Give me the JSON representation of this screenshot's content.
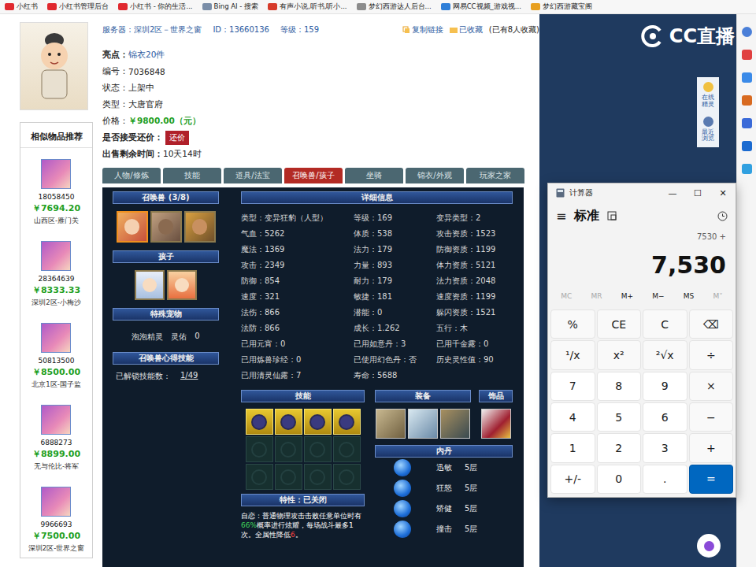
{
  "bookmarks": [
    {
      "label": "小红书",
      "color": "#e0282e"
    },
    {
      "label": "小红书管理后台",
      "color": "#e0282e"
    },
    {
      "label": "小红书 - 你的生活...",
      "color": "#e0282e"
    },
    {
      "label": "Bing AI - 搜索",
      "color": "#7a8ea8"
    },
    {
      "label": "有声小说,听书,听小...",
      "color": "#d63a2a"
    },
    {
      "label": "梦幻西游达人后台...",
      "color": "#8c8c8c"
    },
    {
      "label": "网易CC视频_游戏视...",
      "color": "#2f7fd8"
    },
    {
      "label": "梦幻西游藏宝阁",
      "color": "#e8a020"
    }
  ],
  "header": {
    "server_label": "服务器：",
    "server": "深圳2区－世界之窗",
    "id_label": "ID：",
    "id": "13660136",
    "level_label": "等级：",
    "level": "159",
    "copy": "复制链接",
    "favorite": "已收藏",
    "favorite_count": "(已有8人收藏)"
  },
  "info": [
    {
      "label": "亮点：",
      "value": "锦衣20件",
      "kind": "link"
    },
    {
      "label": "编号：",
      "value": "7036848",
      "kind": "plain"
    },
    {
      "label": "状态：",
      "value": "上架中",
      "kind": "plain"
    },
    {
      "label": "类型：",
      "value": "大唐官府",
      "kind": "plain"
    },
    {
      "label": "价格：",
      "value": "￥9800.00（元）",
      "kind": "price"
    },
    {
      "label": "是否接受还价：",
      "value": "还价",
      "kind": "button"
    },
    {
      "label": "出售剩余时间：",
      "value": "10天14时",
      "kind": "plain"
    }
  ],
  "similar": {
    "title": "相似物品推荐",
    "items": [
      {
        "id": "18058450",
        "price": "￥7694.20",
        "server": "山西区-雁门关"
      },
      {
        "id": "28364639",
        "price": "￥8333.33",
        "server": "深圳2区-小梅沙"
      },
      {
        "id": "50813500",
        "price": "￥8500.00",
        "server": "北京1区-国子监"
      },
      {
        "id": "6888273",
        "price": "￥8899.00",
        "server": "无与伦比-将军"
      },
      {
        "id": "9966693",
        "price": "￥7500.00",
        "server": "深圳2区-世界之窗"
      }
    ]
  },
  "tabs": [
    {
      "label": "人物/修炼",
      "selected": false
    },
    {
      "label": "技能",
      "selected": false
    },
    {
      "label": "道具/法宝",
      "selected": false
    },
    {
      "label": "召唤兽/孩子",
      "selected": true
    },
    {
      "label": "坐骑",
      "selected": false
    },
    {
      "label": "锦衣/外观",
      "selected": false
    },
    {
      "label": "玩家之家",
      "selected": false
    }
  ],
  "panel": {
    "pets": {
      "title": "召唤兽 (3/8)",
      "items": [
        {
          "selected": true
        },
        {
          "selected": false
        },
        {
          "selected": false
        }
      ]
    },
    "children": {
      "title": "孩子",
      "items": [
        {
          "selected": false
        },
        {
          "selected": false
        }
      ]
    },
    "special": {
      "title": "特殊宠物",
      "name": "泡泡精灵",
      "label": "灵佑",
      "value": "0"
    },
    "insight": {
      "title": "召唤兽心得技能",
      "label": "已解锁技能数：",
      "value": "1/49"
    },
    "detail": {
      "title": "详细信息",
      "cells": [
        "类型：变异狂豹（人型）",
        "等级：169",
        "变异类型：2",
        "气血：5262",
        "体质：538",
        "攻击资质：1523",
        "魔法：1369",
        "法力：179",
        "防御资质：1199",
        "攻击：2349",
        "力量：893",
        "体力资质：5121",
        "防御：854",
        "耐力：179",
        "法力资质：2048",
        "速度：321",
        "敏捷：181",
        "速度资质：1199",
        "法伤：866",
        "潜能：0",
        "躲闪资质：1521",
        "法防：866",
        "成长：1.262",
        "五行：木",
        "已用元宵：0",
        "已用如意丹：3",
        "已用千金露：0",
        "已用炼兽珍经：0",
        "已使用幻色丹：否",
        "历史灵性值：90",
        "已用清灵仙露：7",
        "寿命：5688"
      ]
    },
    "skills": {
      "title": "技能",
      "slots": [
        {
          "filled": true
        },
        {
          "filled": true
        },
        {
          "filled": true
        },
        {
          "filled": true
        },
        {
          "filled": false
        },
        {
          "filled": false
        },
        {
          "filled": false
        },
        {
          "filled": false
        },
        {
          "filled": false
        },
        {
          "filled": false
        },
        {
          "filled": false
        },
        {
          "filled": false
        }
      ]
    },
    "equipment": {
      "title": "装备",
      "items": [
        {
          "filled": true
        },
        {
          "filled": true
        },
        {
          "filled": true
        }
      ]
    },
    "accessory": {
      "title": "饰品",
      "items": [
        {
          "filled": true
        }
      ]
    },
    "neidan": {
      "title": "内丹",
      "items": [
        {
          "name": "迅敏",
          "level": "5层"
        },
        {
          "name": "狂怒",
          "level": "5层"
        },
        {
          "name": "矫健",
          "level": "5层"
        },
        {
          "name": "撞击",
          "level": "5层"
        }
      ]
    },
    "trait": {
      "title": "特性：已关闭",
      "parts": [
        {
          "text": "自恋：普通物理攻击击败任意单位时有",
          "color": "#ffffff"
        },
        {
          "text": "66%",
          "color": "#3fd25a"
        },
        {
          "text": "概率进行炫耀，每场战斗最多1次。全属性降低",
          "color": "#ffffff"
        },
        {
          "text": "6",
          "color": "#ff4040"
        },
        {
          "text": "。",
          "color": "#ffffff"
        }
      ]
    }
  },
  "right_panel": {
    "logo": "CC直播",
    "side": [
      {
        "label": "在线精灵"
      },
      {
        "label": "最近浏览"
      }
    ]
  },
  "calculator": {
    "title": "计算器",
    "controls": [
      "—",
      "☐",
      "✕"
    ],
    "menu": "≡",
    "mode": "标准",
    "expression": "7530 +",
    "display": "7,530",
    "memory": [
      {
        "label": "MC",
        "disabled": true
      },
      {
        "label": "MR",
        "disabled": true
      },
      {
        "label": "M+",
        "disabled": false
      },
      {
        "label": "M−",
        "disabled": false
      },
      {
        "label": "MS",
        "disabled": false
      },
      {
        "label": "M˅",
        "disabled": true
      }
    ],
    "keys": [
      {
        "label": "%",
        "kind": "op"
      },
      {
        "label": "CE",
        "kind": "op"
      },
      {
        "label": "C",
        "kind": "op"
      },
      {
        "label": "⌫",
        "kind": "op"
      },
      {
        "label": "¹/x",
        "kind": "op"
      },
      {
        "label": "x²",
        "kind": "op"
      },
      {
        "label": "²√x",
        "kind": "op"
      },
      {
        "label": "÷",
        "kind": "op"
      },
      {
        "label": "7",
        "kind": "digit"
      },
      {
        "label": "8",
        "kind": "digit"
      },
      {
        "label": "9",
        "kind": "digit"
      },
      {
        "label": "×",
        "kind": "op"
      },
      {
        "label": "4",
        "kind": "digit"
      },
      {
        "label": "5",
        "kind": "digit"
      },
      {
        "label": "6",
        "kind": "digit"
      },
      {
        "label": "−",
        "kind": "op"
      },
      {
        "label": "1",
        "kind": "digit"
      },
      {
        "label": "2",
        "kind": "digit"
      },
      {
        "label": "3",
        "kind": "digit"
      },
      {
        "label": "+",
        "kind": "op"
      },
      {
        "label": "+/-",
        "kind": "digit"
      },
      {
        "label": "0",
        "kind": "digit"
      },
      {
        "label": ".",
        "kind": "digit"
      },
      {
        "label": "=",
        "kind": "equals"
      }
    ]
  }
}
